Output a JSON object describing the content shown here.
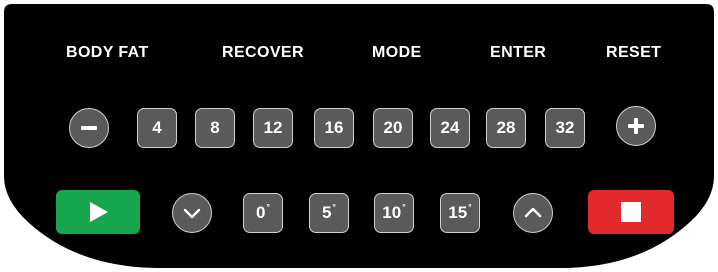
{
  "labels": {
    "body_fat": "BODY FAT",
    "recover": "RECOVER",
    "mode": "MODE",
    "enter": "ENTER",
    "reset": "RESET"
  },
  "speed_keys": [
    "4",
    "8",
    "12",
    "16",
    "20",
    "24",
    "28",
    "32"
  ],
  "incline_keys": [
    "0",
    "5",
    "10",
    "15"
  ],
  "incline_unit": "°",
  "icons": {
    "minus": "minus-icon",
    "plus": "plus-icon",
    "down": "chevron-down-icon",
    "up": "chevron-up-icon",
    "start": "play-icon",
    "stop": "stop-icon"
  },
  "colors": {
    "panel": "#000000",
    "key_fill": "#5a5a5a",
    "key_border": "#cfcfcf",
    "start": "#18a650",
    "stop": "#e2292b"
  }
}
